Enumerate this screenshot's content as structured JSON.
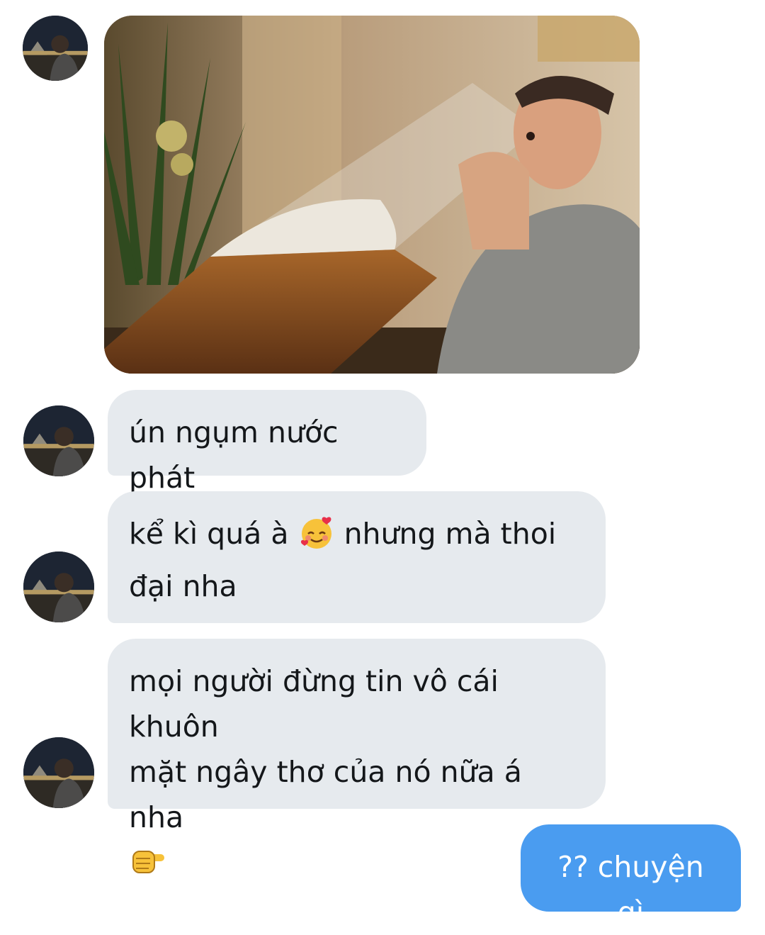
{
  "conversation": {
    "messages": [
      {
        "sender": "other",
        "type": "image",
        "image_alt": ""
      },
      {
        "sender": "other",
        "type": "text",
        "text": "ún ngụm nước phát"
      },
      {
        "sender": "other",
        "type": "text",
        "text_a": "kể kì quá à",
        "emoji_a": "smiling-face-with-hearts-emoji",
        "text_b": "nhưng mà thoi",
        "text_c": "đại nha"
      },
      {
        "sender": "other",
        "type": "text",
        "line_1": "mọi người đừng tin vô cái khuôn",
        "line_2": "mặt ngây thơ của nó nữa á nha",
        "emoji": "backhand-index-pointing-right-emoji"
      },
      {
        "sender": "me",
        "type": "text",
        "text": "?? chuyện gì"
      }
    ]
  },
  "colors": {
    "incoming_bubble": "#e6eaee",
    "outgoing_bubble": "#4a9cf0",
    "incoming_text": "#14171a",
    "outgoing_text": "#ffffff"
  },
  "icons": [
    "avatar",
    "smiling-face-with-hearts-emoji",
    "backhand-index-pointing-right-emoji"
  ]
}
